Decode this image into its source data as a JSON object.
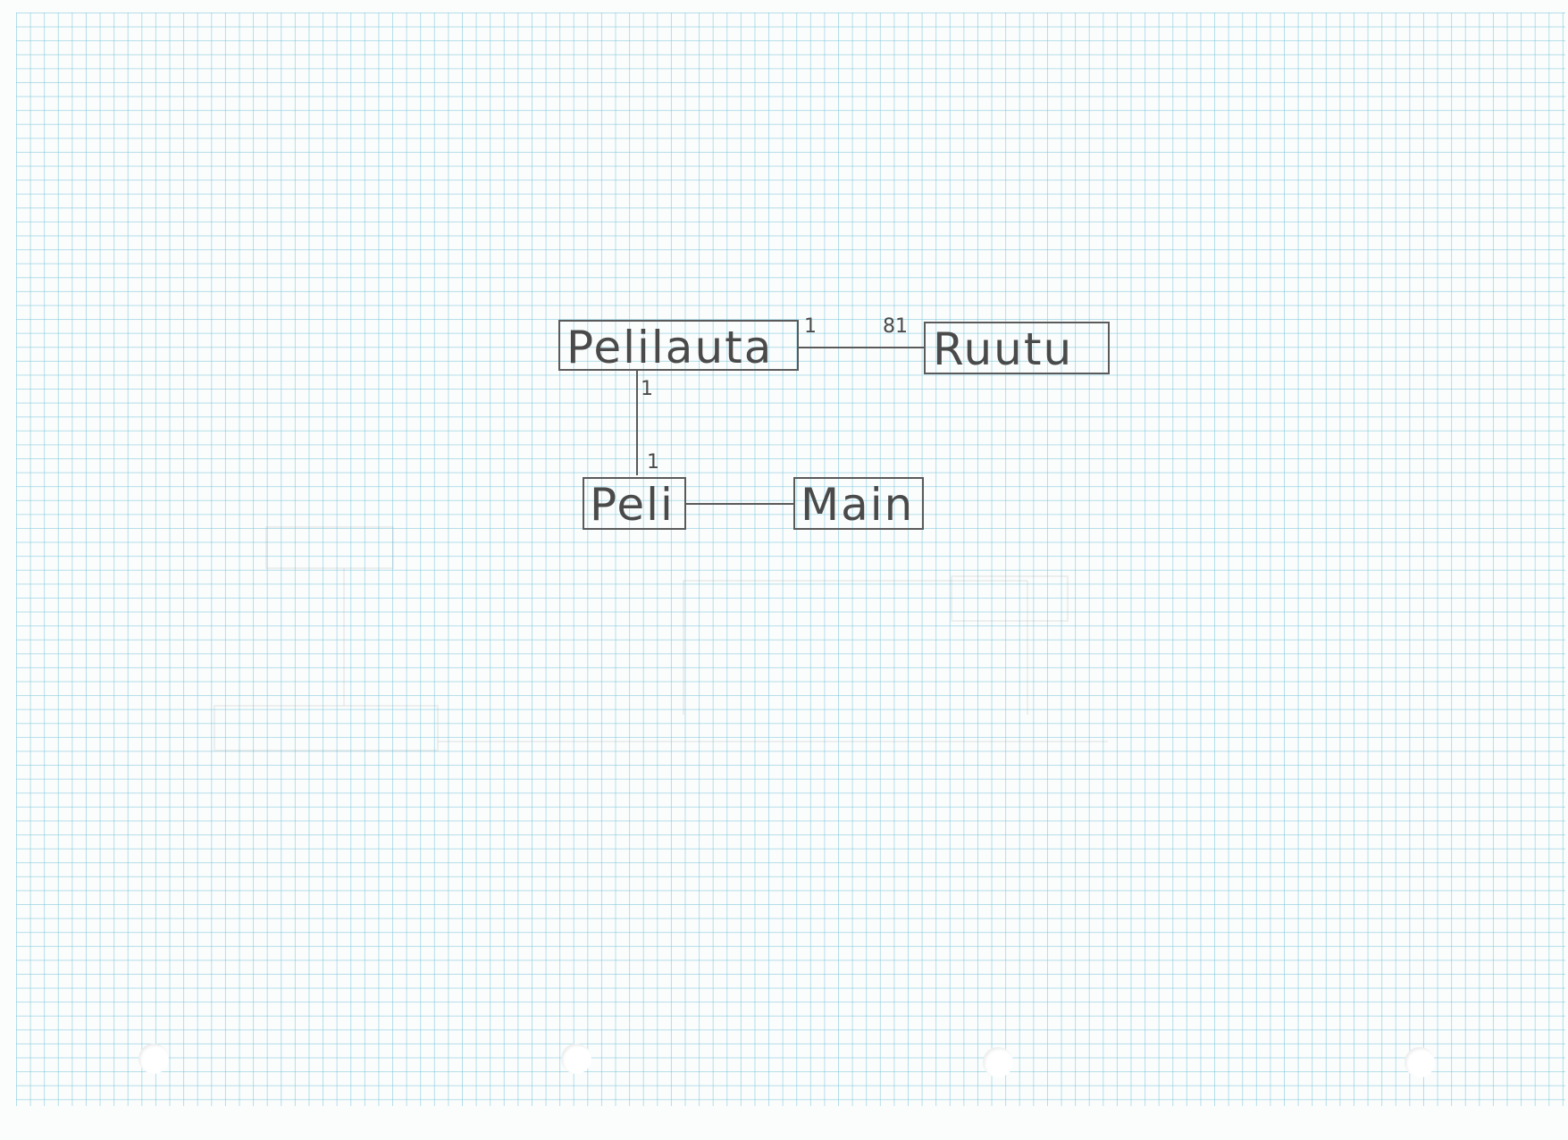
{
  "diagram": {
    "classes": {
      "pelilauta": "Pelilauta",
      "ruutu": "Ruutu",
      "peli": "Peli",
      "main": "Main"
    },
    "associations": {
      "pelilauta_ruutu": {
        "from_mult": "1",
        "to_mult": "81"
      },
      "pelilauta_peli": {
        "from_mult": "1",
        "to_mult": "1"
      },
      "peli_main": {}
    }
  },
  "colors": {
    "paper": "#fbfdfd",
    "grid": "#78c3d7",
    "pencil": "#4a4a4a"
  }
}
